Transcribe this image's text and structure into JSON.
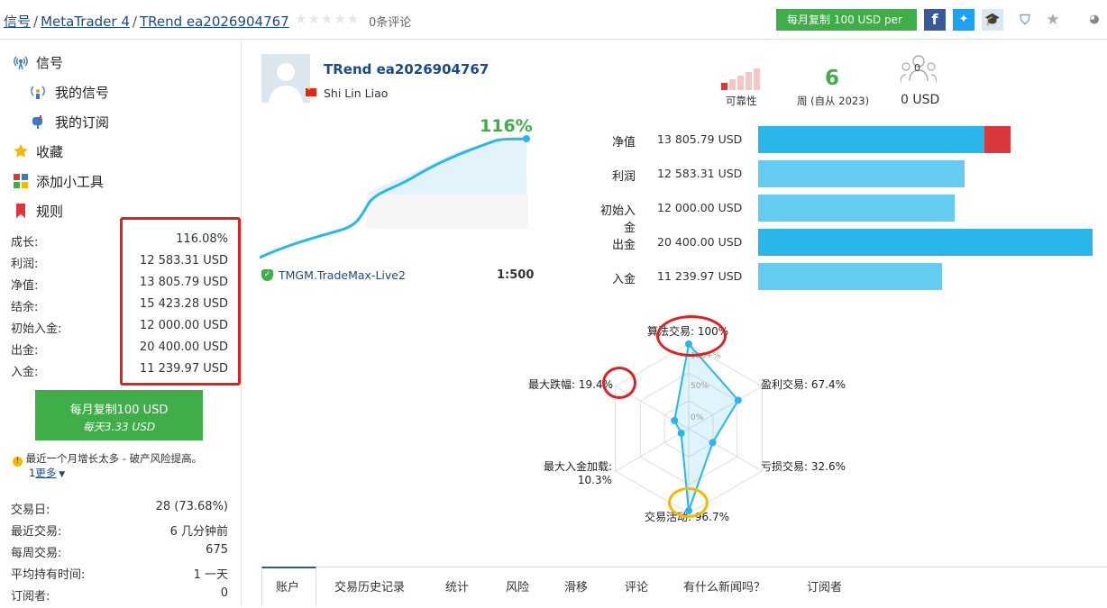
{
  "breadcrumb": {
    "root": "信号",
    "platform": "MetaTrader 4",
    "current": "TRend ea2026904767"
  },
  "rating": {
    "stars": "★★★★★",
    "reviews": "0条评论"
  },
  "copy_button": "每月复制 100 USD per",
  "colors": {
    "green": "#3fae49",
    "blue_dark": "#29b6ea",
    "blue_light": "#65ccf1",
    "red": "#d9393a",
    "link": "#1a4a8a"
  },
  "sidebar": {
    "nav": [
      {
        "label": "信号",
        "icon": "signal-antenna-icon"
      },
      {
        "label": "我的信号",
        "icon": "my-signal-icon"
      },
      {
        "label": "我的订阅",
        "icon": "mailbox-icon"
      },
      {
        "label": "收藏",
        "icon": "star-icon"
      },
      {
        "label": "添加小工具",
        "icon": "widgets-icon"
      },
      {
        "label": "规则",
        "icon": "bookmark-icon"
      }
    ],
    "stats": [
      {
        "label": "成长:",
        "value": "116.08%"
      },
      {
        "label": "利润:",
        "value": "12 583.31 USD"
      },
      {
        "label": "净值:",
        "value": "13 805.79 USD"
      },
      {
        "label": "结余:",
        "value": "15 423.28 USD"
      },
      {
        "label": "初始入金:",
        "value": "12 000.00 USD"
      },
      {
        "label": "出金:",
        "value": "20 400.00 USD"
      },
      {
        "label": "入金:",
        "value": "11 239.97 USD"
      }
    ],
    "subscribe": {
      "line1": "每月复制100 USD",
      "line2": "每天3.33 USD"
    },
    "warning": "最近一个月增长太多 - 破产风险提高。",
    "more_count": "1",
    "more_label": "更多",
    "stats2": [
      {
        "label": "交易日:",
        "value": "28 (73.68%)"
      },
      {
        "label": "最近交易:",
        "value": "6 几分钟前"
      },
      {
        "label": "每周交易:",
        "value": "675"
      },
      {
        "label": "平均持有时间:",
        "value": "1 一天"
      },
      {
        "label": "订阅者:",
        "value": "0"
      }
    ]
  },
  "profile": {
    "name": "TRend ea2026904767",
    "author": "Shi Lin Liao"
  },
  "growth": {
    "value": "116%",
    "broker": "TMGM.TradeMax-Live2",
    "leverage": "1:500"
  },
  "badges": {
    "reliability_label": "可靠性",
    "weeks_value": "6",
    "weeks_label": "周 (自从 2023)",
    "subscribers_count": "0",
    "subscribers_value": "0 USD"
  },
  "bars": [
    {
      "label": "净值",
      "value": "13 805.79 USD",
      "amount": 13805.79,
      "extra": 1617.49,
      "color": "#29b6ea"
    },
    {
      "label": "利润",
      "value": "12 583.31 USD",
      "amount": 12583.31,
      "extra": 0,
      "color": "#65ccf1"
    },
    {
      "label": "初始入金",
      "value": "12 000.00 USD",
      "amount": 12000.0,
      "extra": 0,
      "color": "#65ccf1"
    },
    {
      "label": "出金",
      "value": "20 400.00 USD",
      "amount": 20400.0,
      "extra": 0,
      "color": "#29b6ea"
    },
    {
      "label": "入金",
      "value": "11 239.97 USD",
      "amount": 11239.97,
      "extra": 0,
      "color": "#65ccf1"
    }
  ],
  "radar": {
    "labels": {
      "algo": "算法交易: 100%",
      "profit": "盈利交易: 67.4%",
      "loss": "亏损交易: 32.6%",
      "activity": "交易活动: 96.7%",
      "load_1": "最大入金加载:",
      "load_2": "10.3%",
      "drawdown": "最大跌幅: 19.4%"
    },
    "ticks": [
      "100+%",
      "50%",
      "0%"
    ],
    "values": [
      100,
      67.4,
      32.6,
      96.7,
      10.3,
      19.4
    ]
  },
  "tabs": [
    "账户",
    "交易历史记录",
    "统计",
    "风险",
    "滑移",
    "评论",
    "有什么新闻吗？",
    "订阅者"
  ]
}
